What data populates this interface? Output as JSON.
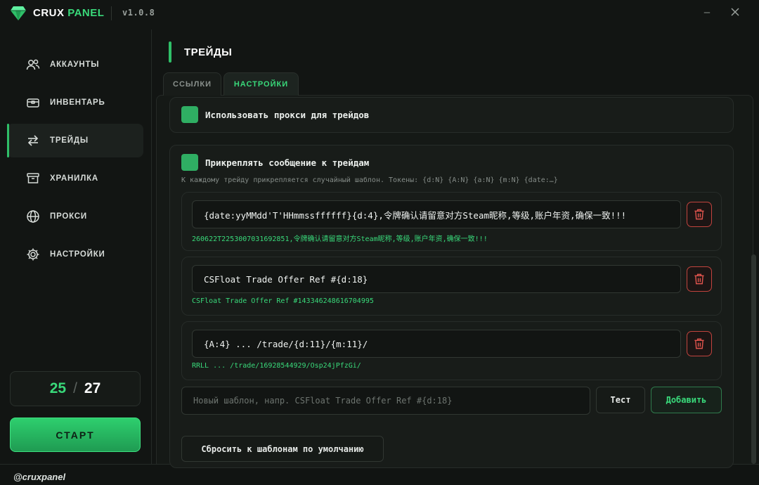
{
  "app": {
    "brand_part1": "CRUX",
    "brand_part2": "PANEL",
    "version": "v1.0.8",
    "accent_color": "#39d97a"
  },
  "window_controls": {
    "minimize": "–"
  },
  "sidebar": {
    "items": [
      {
        "label": "АККАУНТЫ",
        "icon": "users-icon",
        "active": false
      },
      {
        "label": "ИНВЕНТАРЬ",
        "icon": "inventory-icon",
        "active": false
      },
      {
        "label": "ТРЕЙДЫ",
        "icon": "trade-arrows-icon",
        "active": true
      },
      {
        "label": "ХРАНИЛКА",
        "icon": "archive-box-icon",
        "active": false
      },
      {
        "label": "ПРОКСИ",
        "icon": "globe-icon",
        "active": false
      },
      {
        "label": "НАСТРОЙКИ",
        "icon": "gear-icon",
        "active": false
      }
    ],
    "counter": {
      "current": "25",
      "separator": "/",
      "total": "27"
    },
    "start_label": "СТАРТ"
  },
  "footer": {
    "handle": "@cruxpanel"
  },
  "main": {
    "title": "ТРЕЙДЫ",
    "tabs": [
      {
        "label": "ССЫЛКИ",
        "active": false
      },
      {
        "label": "НАСТРОЙКИ",
        "active": true
      }
    ],
    "proxy_option": {
      "label": "Использовать прокси для трейдов",
      "checked": true
    },
    "message_option": {
      "label": "Прикреплять сообщение к трейдам",
      "checked": true,
      "hint": "К каждому трейду прикрепляется случайный шаблон. Токены: {d:N} {A:N} {a:N} {m:N} {date:…}"
    },
    "templates": [
      {
        "value": "{date:yyMMdd'T'HHmmssffffff}{d:4},令牌确认请留意对方Steam昵称,等级,账户年资,确保一致!!!",
        "preview": "260622T2253007031692851,令牌确认请留意对方Steam昵称,等级,账户年资,确保一致!!!"
      },
      {
        "value": "CSFloat Trade Offer Ref #{d:18}",
        "preview": "CSFloat Trade Offer Ref #143346248616704995"
      },
      {
        "value": "{A:4} ... /trade/{d:11}/{m:11}/",
        "preview": "RRLL ... /trade/16928544929/Osp24jPfzGi/"
      }
    ],
    "new_template_placeholder": "Новый шаблон, напр. CSFloat Trade Offer Ref #{d:18}",
    "test_label": "Тест",
    "add_label": "Добавить",
    "reset_label": "Сбросить к шаблонам по умолчанию"
  }
}
